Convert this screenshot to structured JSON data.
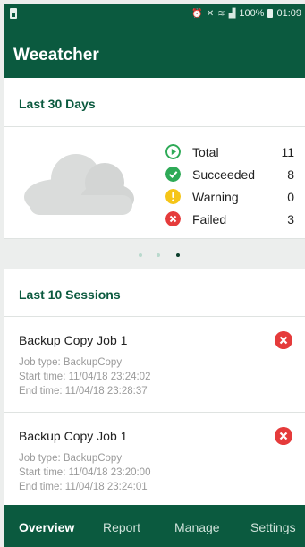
{
  "status_bar": {
    "battery_percent": "100%",
    "time": "01:09"
  },
  "app": {
    "title": "Weeatcher"
  },
  "summary": {
    "title": "Last 30 Days",
    "stats": [
      {
        "label": "Total",
        "value": "11",
        "icon": "play-circle-icon",
        "color": "#2eaa57"
      },
      {
        "label": "Succeeded",
        "value": "8",
        "icon": "check-circle-icon",
        "color": "#2eaa57"
      },
      {
        "label": "Warning",
        "value": "0",
        "icon": "exclamation-circle-icon",
        "color": "#f5c518"
      },
      {
        "label": "Failed",
        "value": "3",
        "icon": "x-circle-icon",
        "color": "#e53b3b"
      }
    ],
    "pager": {
      "count": 3,
      "active": 3
    }
  },
  "sessions": {
    "title": "Last 10 Sessions",
    "items": [
      {
        "name": "Backup Copy Job 1",
        "job_type": "Job type: BackupCopy",
        "start": "Start time: 11/04/18 23:24:02",
        "end": "End time: 11/04/18 23:28:37",
        "status": "failed"
      },
      {
        "name": "Backup Copy Job 1",
        "job_type": "Job type: BackupCopy",
        "start": "Start time: 11/04/18 23:20:00",
        "end": "End time: 11/04/18 23:24:01",
        "status": "failed"
      }
    ]
  },
  "nav": {
    "items": [
      "Overview",
      "Report",
      "Manage",
      "Settings"
    ],
    "active": "Overview"
  },
  "colors": {
    "primary": "#0b5a3f",
    "success": "#2eaa57",
    "warning": "#f5c518",
    "error": "#e53b3b"
  }
}
